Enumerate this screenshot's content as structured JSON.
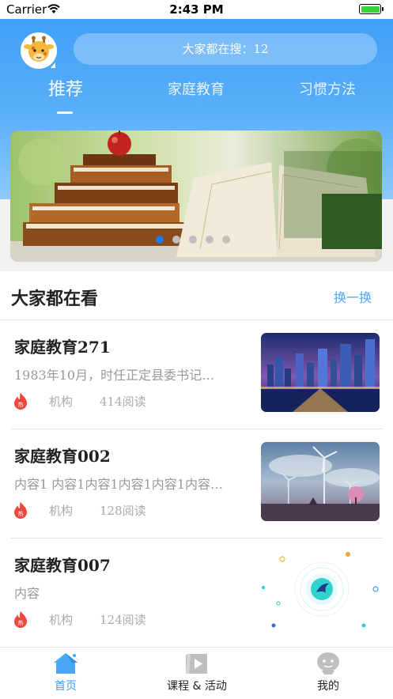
{
  "status_bar": {
    "carrier": "Carrier",
    "time": "2:43 PM"
  },
  "header": {
    "search_text": "大家都在搜：12",
    "tabs": [
      {
        "label": "推荐",
        "active": true
      },
      {
        "label": "家庭教育",
        "active": false
      },
      {
        "label": "习惯方法",
        "active": false
      }
    ]
  },
  "banner": {
    "page_count": 5,
    "active_page": 1
  },
  "section": {
    "title": "大家都在看",
    "refresh_label": "换一换"
  },
  "articles": [
    {
      "title": "家庭教育271",
      "summary": "1983年10月，时任正定县委书记…",
      "hot_label": "热",
      "org": "机构",
      "reads": "414阅读",
      "thumbnail": "city-night"
    },
    {
      "title": "家庭教育002",
      "summary": "内容1 内容1内容1内容1内容1内容…",
      "hot_label": "热",
      "org": "机构",
      "reads": "128阅读",
      "thumbnail": "windmills"
    },
    {
      "title": "家庭教育007",
      "summary": "内容",
      "hot_label": "热",
      "org": "机构",
      "reads": "124阅读",
      "thumbnail": "app-logo"
    }
  ],
  "tabbar": {
    "items": [
      {
        "label": "首页",
        "icon": "home-icon",
        "active": true
      },
      {
        "label": "课程 & 活动",
        "icon": "play-icon",
        "active": false
      },
      {
        "label": "我的",
        "icon": "user-icon",
        "active": false
      }
    ]
  },
  "colors": {
    "accent": "#3b9bf6",
    "header_top": "#3c9df7",
    "hot": "#f0463c"
  }
}
